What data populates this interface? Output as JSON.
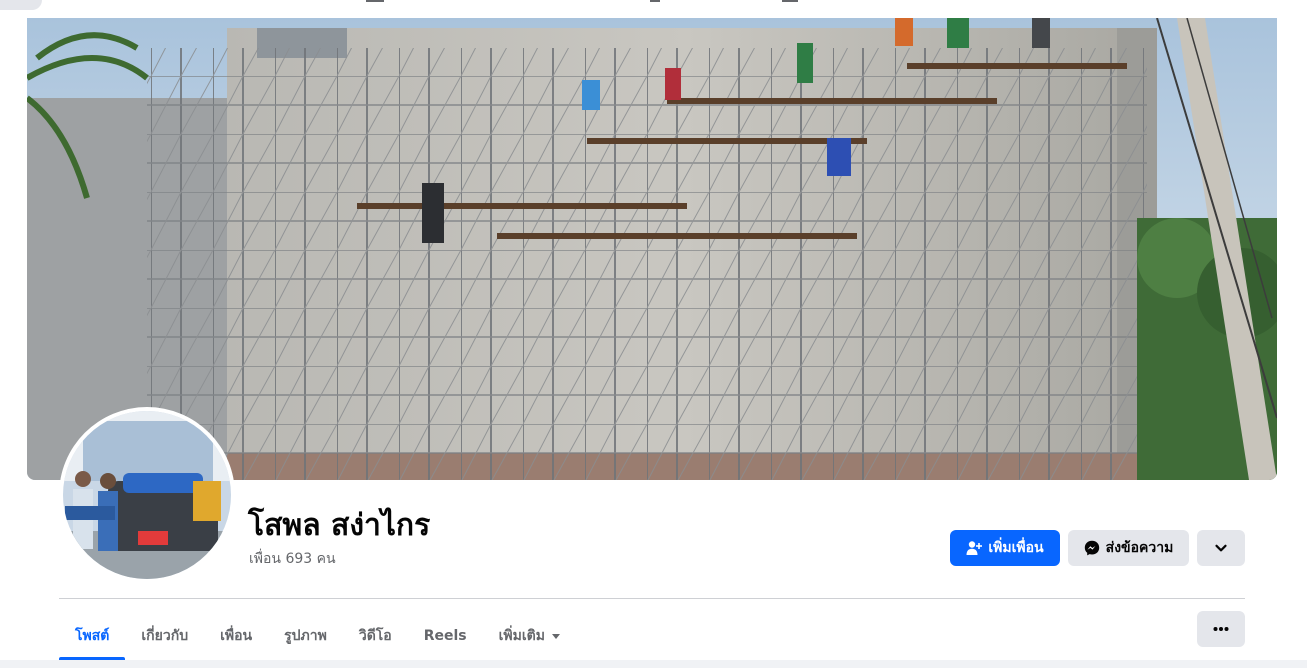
{
  "profile": {
    "name": "โสพล สง่าไกร",
    "friends_count": "เพื่อน 693 คน"
  },
  "actions": {
    "add_friend_label": "เพิ่มเพื่อน",
    "message_label": "ส่งข้อความ",
    "more_icon": "chevron-down-icon"
  },
  "tabs": [
    {
      "label": "โพสต์",
      "active": true
    },
    {
      "label": "เกี่ยวกับ",
      "active": false
    },
    {
      "label": "เพื่อน",
      "active": false
    },
    {
      "label": "รูปภาพ",
      "active": false
    },
    {
      "label": "วิดีโอ",
      "active": false
    },
    {
      "label": "Reels",
      "active": false
    },
    {
      "label": "เพิ่มเติม",
      "active": false,
      "has_dropdown": true
    }
  ],
  "colors": {
    "accent": "#0866ff",
    "secondary_button": "#e4e6eb",
    "muted_text": "#65676b",
    "page_background": "#f0f2f5"
  }
}
